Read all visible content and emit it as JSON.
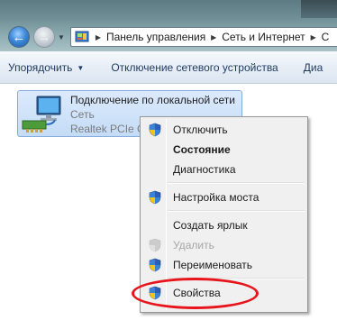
{
  "navigation": {
    "back_glyph": "←",
    "forward_glyph": "→",
    "history_glyph": "▼"
  },
  "address_bar": {
    "icon": "control-panel-icon",
    "separator_glyph": "▶",
    "breadcrumbs": [
      "Панель управления",
      "Сеть и Интернет",
      "С"
    ]
  },
  "command_bar": {
    "organize_label": "Упорядочить",
    "organize_arrow": "▼",
    "disable_device_label": "Отключение сетевого устройства",
    "diagnose_label": "Диа"
  },
  "connection": {
    "icon": "network-adapter-icon",
    "name": "Подключение по локальной сети",
    "network": "Сеть",
    "adapter": "Realtek PCIe GB"
  },
  "context_menu": {
    "items": [
      {
        "label": "Отключить",
        "icon": "uac-shield-icon"
      },
      {
        "label": "Состояние",
        "bold": true
      },
      {
        "label": "Диагностика"
      },
      {
        "label": "Настройка моста",
        "icon": "uac-shield-icon"
      },
      {
        "label": "Создать ярлык"
      },
      {
        "label": "Удалить",
        "icon": "uac-shield-icon",
        "disabled": true
      },
      {
        "label": "Переименовать",
        "icon": "uac-shield-icon"
      },
      {
        "label": "Свойства",
        "icon": "uac-shield-icon",
        "highlighted": true
      }
    ]
  },
  "colors": {
    "highlight_oval": "#e8141b",
    "selection_fill": "#c4dcf7",
    "menu_background": "#f0f0f0"
  }
}
